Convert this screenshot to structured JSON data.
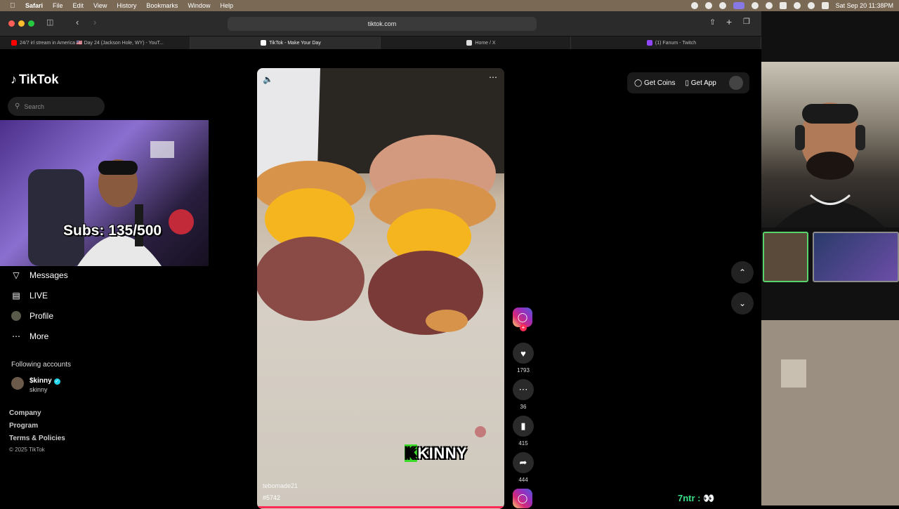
{
  "menubar": {
    "app": "Safari",
    "items": [
      "File",
      "Edit",
      "View",
      "History",
      "Bookmarks",
      "Window",
      "Help"
    ],
    "clock": "Sat Sep 20  11:38PM"
  },
  "browser": {
    "url": "tiktok.com",
    "tabs": [
      {
        "label": "24/7 irl stream in America 🇺🇸 Day 24 (Jackson Hole, WY) - YouT...",
        "favicon_color": "#ff0000"
      },
      {
        "label": "TikTok - Make Your Day",
        "favicon_color": "#000000"
      },
      {
        "label": "Home / X",
        "favicon_color": "#000000"
      },
      {
        "label": "(1) Fanum - Twitch",
        "favicon_color": "#9146ff"
      }
    ],
    "active_tab": 1
  },
  "tiktok": {
    "logo": "TikTok",
    "search_placeholder": "Search",
    "nav": [
      {
        "label": "Messages",
        "icon": "send-icon"
      },
      {
        "label": "LIVE",
        "icon": "live-icon"
      },
      {
        "label": "Profile",
        "icon": "avatar-icon"
      },
      {
        "label": "More",
        "icon": "more-icon"
      }
    ],
    "following_title": "Following accounts",
    "following": [
      {
        "name": "$kinny",
        "handle": "skinny",
        "verified": true
      }
    ],
    "footer_links": [
      "Company",
      "Program",
      "Terms & Policies"
    ],
    "copyright": "© 2025 TikTok",
    "top_buttons": {
      "coins": "Get Coins",
      "app": "Get App"
    },
    "video": {
      "username": "tebomade21",
      "tag": "#5742"
    },
    "actions": {
      "likes": "1793",
      "comments": "36",
      "saves": "415",
      "shares": "444"
    }
  },
  "overlay": {
    "subs": "Subs: 135/500",
    "brand": "SKINNY",
    "brand_letter": "K",
    "ticker_name": "7ntr :",
    "ticker_emoji": "👀"
  }
}
